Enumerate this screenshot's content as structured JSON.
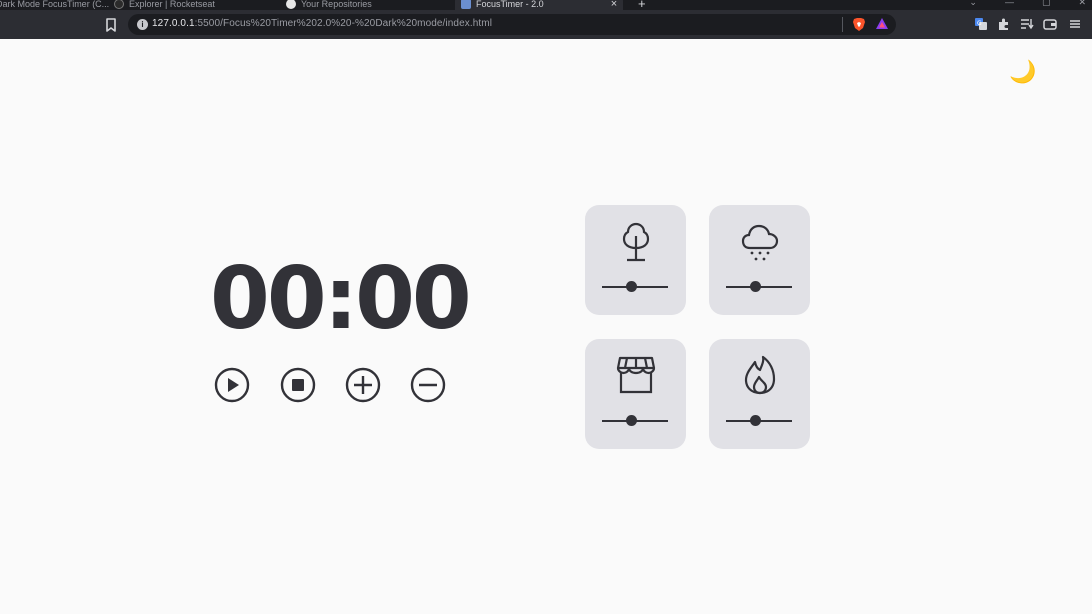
{
  "browser": {
    "tabs": [
      {
        "label": "Dark Mode FocusTimer (C...",
        "active": false
      },
      {
        "label": "Explorer | Rocketseat",
        "active": false
      },
      {
        "label": "Your Repositories",
        "active": false
      },
      {
        "label": "FocusTimer - 2.0",
        "active": true
      }
    ],
    "new_tab_label": "+",
    "close_tab_label": "×",
    "address": {
      "host": "127.0.0.1",
      "path": ":5500/Focus%20Timer%202.0%20-%20Dark%20mode/index.html"
    }
  },
  "page": {
    "theme_toggle": {
      "icon": "moon-icon",
      "glyph": "🌙"
    },
    "timer": {
      "minutes": "00",
      "separator": ":",
      "seconds": "00"
    },
    "controls": [
      {
        "name": "play-button",
        "icon": "play-icon"
      },
      {
        "name": "stop-button",
        "icon": "stop-icon"
      },
      {
        "name": "plus-button",
        "icon": "plus-icon"
      },
      {
        "name": "minus-button",
        "icon": "minus-icon"
      }
    ],
    "sound_cards": [
      {
        "name": "forest",
        "icon": "tree-icon",
        "volume": 0.45
      },
      {
        "name": "rain",
        "icon": "rain-cloud-icon",
        "volume": 0.45
      },
      {
        "name": "coffee-shop",
        "icon": "store-icon",
        "volume": 0.45
      },
      {
        "name": "fireplace",
        "icon": "fire-icon",
        "volume": 0.45
      }
    ]
  },
  "colors": {
    "text": "#323238",
    "card_background": "#e1e1e6",
    "page_background": "#fafafa",
    "moon": "#f5c400"
  }
}
